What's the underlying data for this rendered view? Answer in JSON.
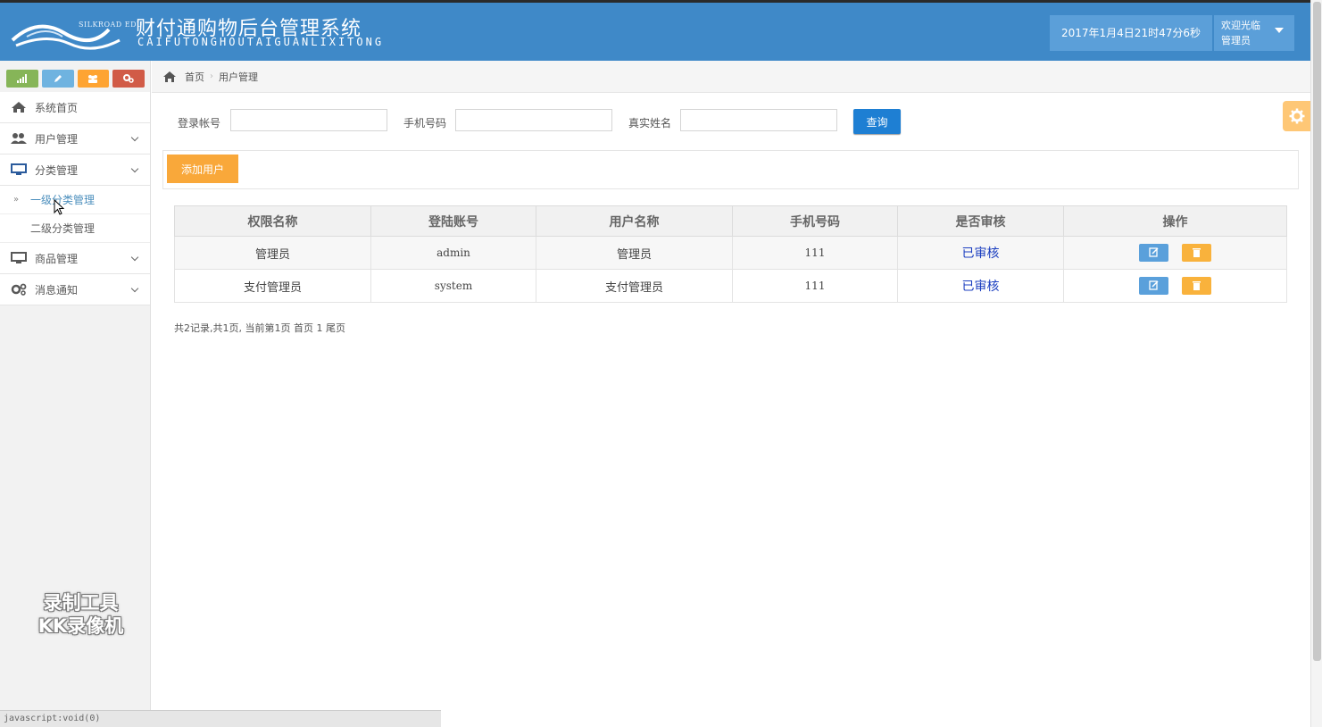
{
  "header": {
    "logo_small_text": "SILKROAD EDU",
    "title_cn": "财付通购物后台管理系统",
    "title_pinyin": "CAIFUTONGHOUTAIGUANLIXITONG",
    "datetime": "2017年1月4日21时47分6秒",
    "welcome": "欢迎光临",
    "username": "管理员"
  },
  "sidebar": {
    "menu": [
      {
        "label": "系统首页",
        "icon": "home-icon"
      },
      {
        "label": "用户管理",
        "icon": "users-icon"
      },
      {
        "label": "分类管理",
        "icon": "desktop-icon"
      },
      {
        "label": "商品管理",
        "icon": "desktop-icon"
      },
      {
        "label": "消息通知",
        "icon": "cogs-icon"
      }
    ],
    "submenu": [
      {
        "label": "一级分类管理"
      },
      {
        "label": "二级分类管理"
      }
    ],
    "watermark_line1": "录制工具",
    "watermark_line2": "KK录像机"
  },
  "breadcrumb": {
    "home": "首页",
    "current": "用户管理"
  },
  "search": {
    "login_label": "登录帐号",
    "login_value": "",
    "phone_label": "手机号码",
    "phone_value": "",
    "name_label": "真实姓名",
    "name_value": "",
    "query_label": "查询"
  },
  "actions": {
    "add_user_label": "添加用户"
  },
  "table": {
    "columns": [
      "权限名称",
      "登陆账号",
      "用户名称",
      "手机号码",
      "是否审核",
      "操作"
    ],
    "rows": [
      {
        "role": "管理员",
        "account": "admin",
        "name": "管理员",
        "phone": "111",
        "status": "已审核"
      },
      {
        "role": "支付管理员",
        "account": "system",
        "name": "支付管理员",
        "phone": "111",
        "status": "已审核"
      }
    ]
  },
  "pager": {
    "text": "共2记录,共1页, 当前第1页 首页 1 尾页"
  },
  "statusbar": {
    "text": "javascript:void(0)"
  },
  "colors": {
    "header_bg": "#3f89c8",
    "primary_btn": "#1e7fd3",
    "add_btn": "#f9a83a",
    "status_link": "#1c3fc0"
  }
}
